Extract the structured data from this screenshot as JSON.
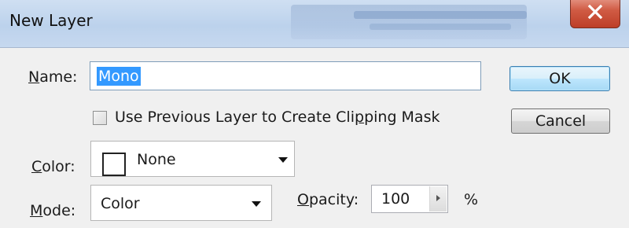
{
  "window": {
    "title": "New Layer",
    "close_label": "X"
  },
  "form": {
    "name": {
      "label": "Name:",
      "label_mnemonic": "N",
      "label_rest": "ame:",
      "value": "Mono"
    },
    "clipping": {
      "label_before": "Use Previous Layer to Create Cli",
      "label_mnemonic": "p",
      "label_after": "ping Mask",
      "checked": false
    },
    "color": {
      "label_mnemonic": "C",
      "label_rest": "olor:",
      "value": "None",
      "swatch_color": "#ffffff"
    },
    "mode": {
      "label_mnemonic": "M",
      "label_rest": "ode:",
      "value": "Color"
    },
    "opacity": {
      "label_mnemonic": "O",
      "label_rest": "pacity:",
      "value": "100",
      "unit": "%"
    }
  },
  "buttons": {
    "ok": "OK",
    "cancel": "Cancel"
  },
  "colors": {
    "selection": "#3399ff",
    "default_button_border": "#3c7fb1",
    "close_button": "#c94a33"
  }
}
